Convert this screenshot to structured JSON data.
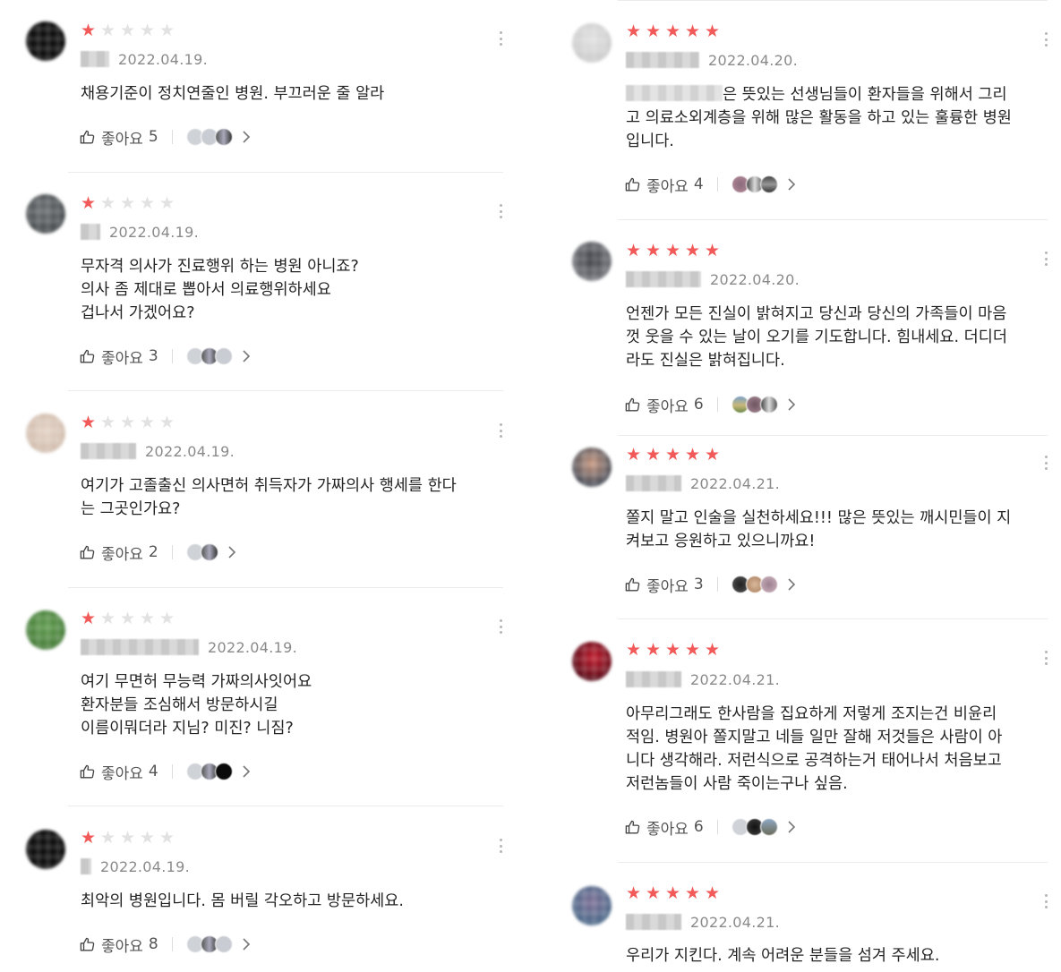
{
  "colors": {
    "star_on": "#f25a5a",
    "star_off": "#e2e2e2",
    "text": "#242424",
    "date": "#8a8a8a"
  },
  "icons": {
    "like": "thumbs-up-icon",
    "more": "more-vertical-icon",
    "expand": "chevron-right-icon",
    "star": "star-icon"
  },
  "like_label": "좋아요",
  "left_reviews": [
    {
      "rating": 1,
      "date": "2022.04.19.",
      "body": "채용기준이 정치연줄인 병원. 부끄러운 줄 알라",
      "likes": "5"
    },
    {
      "rating": 1,
      "date": "2022.04.19.",
      "body": "무자격 의사가 진료행위 하는 병원 아니죠?\n의사 좀 제대로 뽑아서 의료행위하세요\n겁나서 가겠어요?",
      "likes": "3"
    },
    {
      "rating": 1,
      "date": "2022.04.19.",
      "body": "여기가 고졸출신 의사면허 취득자가 가짜의사 행세를 한다\n는 그곳인가요?",
      "likes": "2"
    },
    {
      "rating": 1,
      "date": "2022.04.19.",
      "body": "여기 무면허 무능력 가짜의사잇어요\n환자분들 조심해서 방문하시길\n이름이뭐더라 지님? 미진? 니짐?",
      "likes": "4"
    },
    {
      "rating": 1,
      "date": "2022.04.19.",
      "body": "최악의 병원입니다. 몸 버릴 각오하고 방문하세요.",
      "likes": "8"
    }
  ],
  "right_reviews": [
    {
      "rating": 5,
      "date": "2022.04.20.",
      "body_suffix": "은 뜻있는 선생님들이 환자들을 위해서 그리\n고 의료소외계층을 위해 많은 활동을 하고 있는 훌륭한 병원\n입니다.",
      "likes": "4"
    },
    {
      "rating": 5,
      "date": "2022.04.20.",
      "body": "언젠가 모든 진실이 밝혀지고 당신과 당신의 가족들이 마음\n껏 웃을 수 있는 날이 오기를 기도합니다. 힘내세요. 더디더\n라도 진실은 밝혀집니다.",
      "likes": "6"
    },
    {
      "rating": 5,
      "date": "2022.04.21.",
      "body": "쫄지 말고 인술을 실천하세요!!! 많은 뜻있는 깨시민들이 지\n켜보고 응원하고 있으니까요!",
      "likes": "3"
    },
    {
      "rating": 5,
      "date": "2022.04.21.",
      "body": "아무리그래도 한사람을 집요하게 저렇게 조지는건 비윤리\n적임. 병원아 쫄지말고 네들 일만 잘해 저것들은 사람이 아\n니다 생각해라. 저런식으로 공격하는거 태어나서 처음보고\n저런놈들이 사람 죽이는구나 싶음.",
      "likes": "6"
    },
    {
      "rating": 5,
      "date": "2022.04.21.",
      "body": "우리가 지킨다. 계속 어려운 분들을 섬겨 주세요.",
      "likes": ""
    }
  ]
}
